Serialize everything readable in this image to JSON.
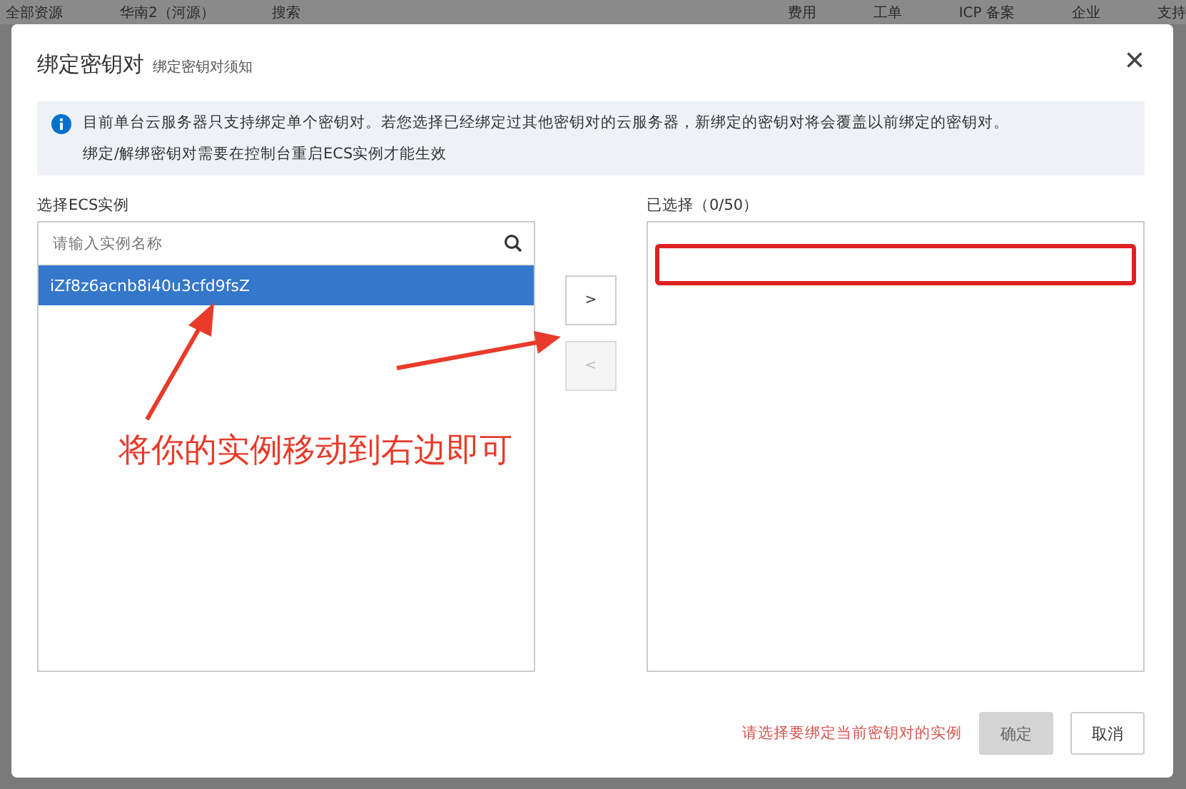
{
  "background_bar": {
    "items": [
      "全部资源",
      "华南2（河源）",
      "搜索",
      "费用",
      "工单",
      "ICP 备案",
      "企业",
      "支持"
    ]
  },
  "dialog": {
    "title": "绑定密钥对",
    "subtitle": "绑定密钥对须知",
    "close": "×",
    "notice": [
      "目前单台云服务器只支持绑定单个密钥对。若您选择已经绑定过其他密钥对的云服务器，新绑定的密钥对将会覆盖以前绑定的密钥对。",
      "绑定/解绑密钥对需要在控制台重启ECS实例才能生效"
    ],
    "source": {
      "label": "选择ECS实例",
      "search": {
        "placeholder": "请输入实例名称"
      },
      "items": [
        {
          "name": "iZf8z6acnb8i40u3cfd9fsZ",
          "selected": true
        }
      ]
    },
    "transfer_buttons": [
      {
        "label": ">",
        "disabled": false
      },
      {
        "label": "<",
        "disabled": true
      }
    ],
    "target": {
      "label": "已选择（0/50）"
    },
    "footer": {
      "error": "请选择要绑定当前密钥对的实例",
      "buttons": [
        {
          "label": "确定",
          "kind": "primary",
          "disabled": true
        },
        {
          "label": "取消",
          "kind": "default",
          "disabled": false
        }
      ]
    }
  },
  "annotation": {
    "text": "将你的实例移动到右边即可"
  }
}
